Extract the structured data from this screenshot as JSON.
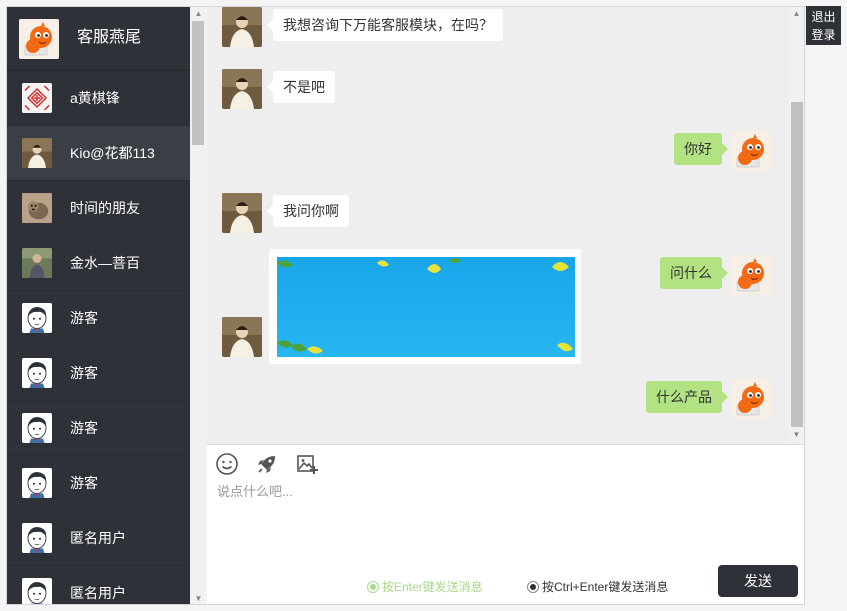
{
  "current_user": {
    "name": "客服燕尾",
    "avatar": "orange-mascot"
  },
  "logout_label": "退出\n登录",
  "contacts": [
    {
      "name": "a黄棋锋",
      "avatar": "red-pattern"
    },
    {
      "name": "Kio@花都113",
      "avatar": "person-photo"
    },
    {
      "name": "时间的朋友",
      "avatar": "dog-photo"
    },
    {
      "name": "金水—菩百",
      "avatar": "man-photo"
    },
    {
      "name": "游客",
      "avatar": "cartoon-boy"
    },
    {
      "name": "游客",
      "avatar": "cartoon-boy"
    },
    {
      "name": "游客",
      "avatar": "cartoon-boy"
    },
    {
      "name": "游客",
      "avatar": "cartoon-boy"
    },
    {
      "name": "匿名用户",
      "avatar": "cartoon-boy"
    },
    {
      "name": "匿名用户",
      "avatar": "cartoon-boy"
    }
  ],
  "active_contact": "Kio@花都113",
  "messages": [
    {
      "side": "left",
      "type": "text",
      "text": "我想咨询下万能客服模块，在吗？"
    },
    {
      "side": "left",
      "type": "text",
      "text": "不是吧"
    },
    {
      "side": "right",
      "type": "text",
      "text": "你好"
    },
    {
      "side": "left",
      "type": "text",
      "text": "我问你啊"
    },
    {
      "side": "right",
      "type": "text",
      "text": "问什么"
    },
    {
      "side": "left",
      "type": "image",
      "image": "blue-sky-leaves"
    },
    {
      "side": "right",
      "type": "text",
      "text": "什么产品"
    }
  ],
  "composer": {
    "tools": [
      "smiley-icon",
      "rocket-icon",
      "image-add-icon"
    ],
    "placeholder": "说点什么吧...",
    "send_enter_label": "按Enter键发送消息",
    "send_ctrl_enter_label": "按Ctrl+Enter键发送消息",
    "selected_send_mode": "ctrl_enter",
    "send_label": "发送"
  },
  "colors": {
    "sidebar": "#2e3238",
    "bubble_right": "#b2e281",
    "bubble_left": "#ffffff",
    "chat_bg": "#eeeeee",
    "enter_option": "#a8d88a"
  }
}
